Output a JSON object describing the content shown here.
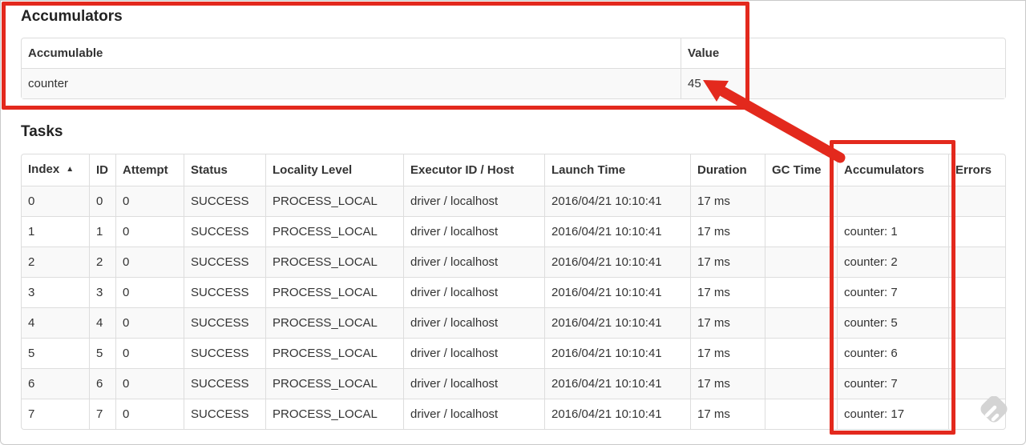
{
  "colors": {
    "annotation_red": "#e3291d",
    "row_stripe": "#f9f9f9",
    "table_border": "#dddddd",
    "text": "#333333"
  },
  "accumulators_section": {
    "title": "Accumulators",
    "table": {
      "headers": {
        "accumulable": "Accumulable",
        "value": "Value"
      },
      "rows": [
        {
          "accumulable": "counter",
          "value": "45"
        }
      ]
    }
  },
  "tasks_section": {
    "title": "Tasks",
    "table": {
      "sort_icon": "▲",
      "headers": {
        "index": "Index",
        "id": "ID",
        "attempt": "Attempt",
        "status": "Status",
        "locality_level": "Locality Level",
        "executor_id_host": "Executor ID / Host",
        "launch_time": "Launch Time",
        "duration": "Duration",
        "gc_time": "GC Time",
        "accumulators": "Accumulators",
        "errors": "Errors"
      },
      "rows": [
        {
          "index": "0",
          "id": "0",
          "attempt": "0",
          "status": "SUCCESS",
          "locality_level": "PROCESS_LOCAL",
          "executor_id_host": "driver / localhost",
          "launch_time": "2016/04/21 10:10:41",
          "duration": "17 ms",
          "gc_time": "",
          "accumulators": "",
          "errors": ""
        },
        {
          "index": "1",
          "id": "1",
          "attempt": "0",
          "status": "SUCCESS",
          "locality_level": "PROCESS_LOCAL",
          "executor_id_host": "driver / localhost",
          "launch_time": "2016/04/21 10:10:41",
          "duration": "17 ms",
          "gc_time": "",
          "accumulators": "counter: 1",
          "errors": ""
        },
        {
          "index": "2",
          "id": "2",
          "attempt": "0",
          "status": "SUCCESS",
          "locality_level": "PROCESS_LOCAL",
          "executor_id_host": "driver / localhost",
          "launch_time": "2016/04/21 10:10:41",
          "duration": "17 ms",
          "gc_time": "",
          "accumulators": "counter: 2",
          "errors": ""
        },
        {
          "index": "3",
          "id": "3",
          "attempt": "0",
          "status": "SUCCESS",
          "locality_level": "PROCESS_LOCAL",
          "executor_id_host": "driver / localhost",
          "launch_time": "2016/04/21 10:10:41",
          "duration": "17 ms",
          "gc_time": "",
          "accumulators": "counter: 7",
          "errors": ""
        },
        {
          "index": "4",
          "id": "4",
          "attempt": "0",
          "status": "SUCCESS",
          "locality_level": "PROCESS_LOCAL",
          "executor_id_host": "driver / localhost",
          "launch_time": "2016/04/21 10:10:41",
          "duration": "17 ms",
          "gc_time": "",
          "accumulators": "counter: 5",
          "errors": ""
        },
        {
          "index": "5",
          "id": "5",
          "attempt": "0",
          "status": "SUCCESS",
          "locality_level": "PROCESS_LOCAL",
          "executor_id_host": "driver / localhost",
          "launch_time": "2016/04/21 10:10:41",
          "duration": "17 ms",
          "gc_time": "",
          "accumulators": "counter: 6",
          "errors": ""
        },
        {
          "index": "6",
          "id": "6",
          "attempt": "0",
          "status": "SUCCESS",
          "locality_level": "PROCESS_LOCAL",
          "executor_id_host": "driver / localhost",
          "launch_time": "2016/04/21 10:10:41",
          "duration": "17 ms",
          "gc_time": "",
          "accumulators": "counter: 7",
          "errors": ""
        },
        {
          "index": "7",
          "id": "7",
          "attempt": "0",
          "status": "SUCCESS",
          "locality_level": "PROCESS_LOCAL",
          "executor_id_host": "driver / localhost",
          "launch_time": "2016/04/21 10:10:41",
          "duration": "17 ms",
          "gc_time": "",
          "accumulators": "counter: 17",
          "errors": ""
        }
      ]
    }
  }
}
